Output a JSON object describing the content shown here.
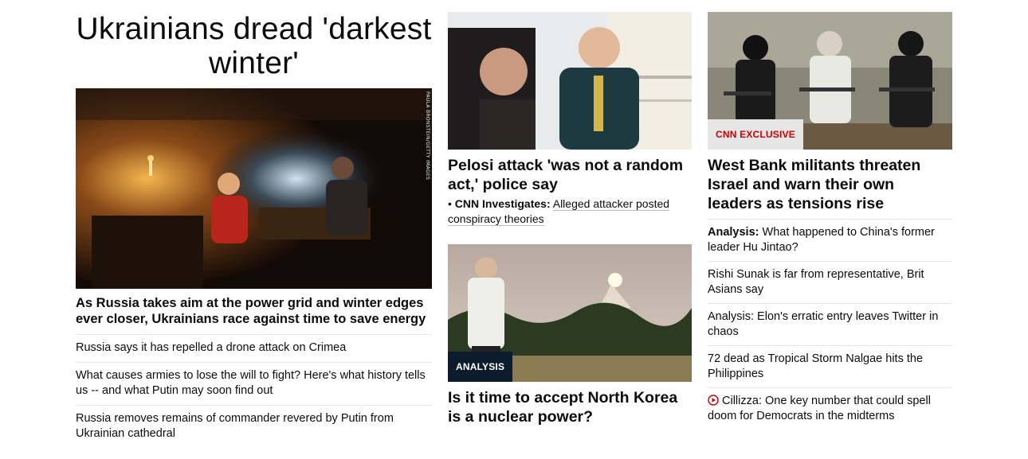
{
  "col1": {
    "headline": "Ukrainians dread 'darkest winter'",
    "image_credit": "PAULA BRONSTEIN/GETTY IMAGES",
    "lead": "As Russia takes aim at the power grid and winter edges ever closer, Ukrainians race against time to save energy",
    "items": [
      "Russia says it has repelled a drone attack on Crimea",
      "What causes armies to lose the will to fight? Here's what history tells us -- and what Putin may soon find out",
      "Russia removes remains of commander revered by Putin from Ukrainian cathedral"
    ]
  },
  "col2": {
    "story1": {
      "headline": "Pelosi attack 'was not a random act,' police say",
      "sub_bullet": "•",
      "sub_label": "CNN Investigates:",
      "sub_text": "Alleged attacker posted conspiracy theories"
    },
    "story2": {
      "badge": "ANALYSIS",
      "headline": "Is it time to accept North Korea is a nuclear power?"
    }
  },
  "col3": {
    "badge": "CNN EXCLUSIVE",
    "headline": "West Bank militants threaten Israel and warn their own leaders as tensions rise",
    "items": [
      {
        "label": "Analysis:",
        "text": "What happened to China's former leader Hu Jintao?"
      },
      {
        "label": "",
        "text": "Rishi Sunak is far from representative, Brit Asians say"
      },
      {
        "label": "",
        "text": "Analysis: Elon's erratic entry leaves Twitter in chaos"
      },
      {
        "label": "",
        "text": "72 dead as Tropical Storm Nalgae hits the Philippines"
      },
      {
        "label": "",
        "text": "Cillizza: One key number that could spell doom for Democrats in the midterms",
        "icon": "play-icon"
      }
    ]
  },
  "colors": {
    "exclusive_red": "#cc0000",
    "analysis_navy": "#0c1c2c",
    "divider": "#e6e6e6"
  }
}
